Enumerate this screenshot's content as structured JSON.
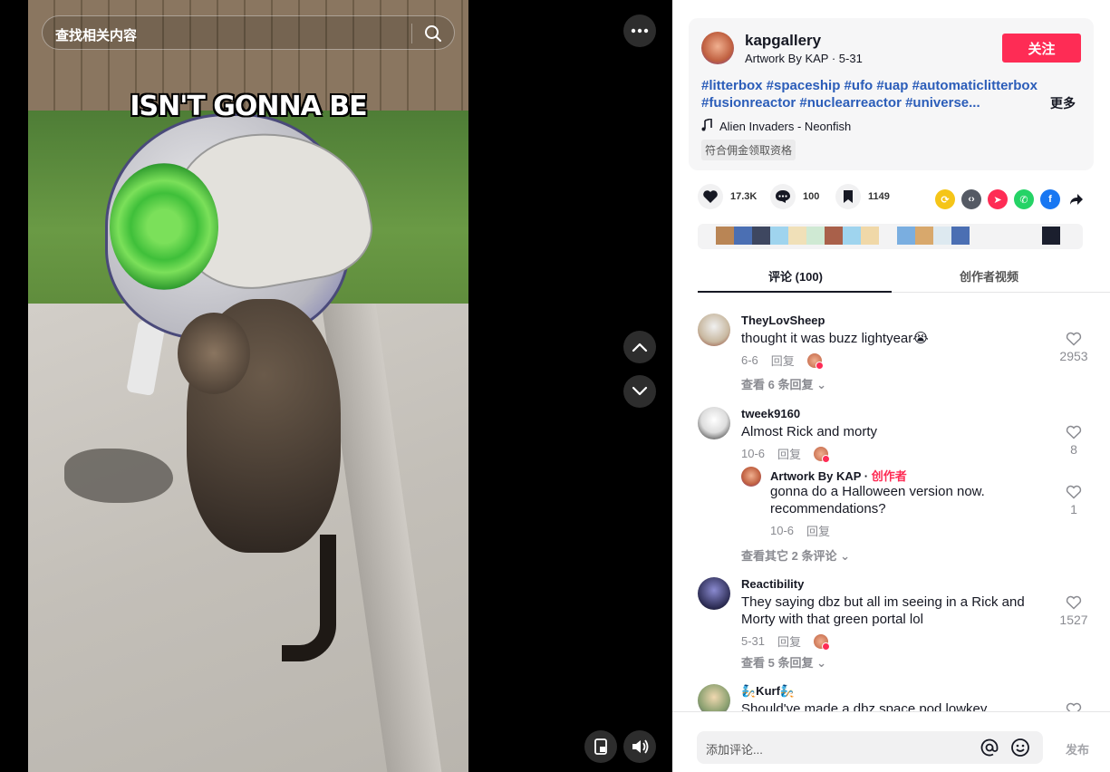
{
  "video": {
    "caption": "ISN'T GONNA BE",
    "search_placeholder": "查找相关内容"
  },
  "author": {
    "username": "kapgallery",
    "display_line": "Artwork By KAP · 5-31",
    "follow_label": "关注"
  },
  "description": {
    "tags_line1": "#litterbox #spaceship #ufo #uap #automaticlitterbox",
    "tags_line2": "#fusionreactor #nuclearreactor #universe...",
    "more_label": "更多",
    "music": "Alien Invaders - Neonfish",
    "commission_label": "符合佣金领取资格"
  },
  "stats": {
    "likes": "17.3K",
    "comments": "100",
    "saves": "1149"
  },
  "tabs": {
    "comments": "评论 (100)",
    "creator_videos": "创作者视频"
  },
  "comments": [
    {
      "user": "TheyLovSheep",
      "text": "thought it was buzz lightyear😭",
      "date": "6-6",
      "reply_label": "回复",
      "likes": "2953",
      "view_replies": "查看 6 条回复"
    },
    {
      "user": "tweek9160",
      "text": "Almost Rick and morty",
      "date": "10-6",
      "reply_label": "回复",
      "likes": "8",
      "reply": {
        "user": "Artwork By KAP",
        "badge": "创作者",
        "text": "gonna do a Halloween version now. recommendations?",
        "date": "10-6",
        "reply_label": "回复",
        "likes": "1"
      },
      "view_replies": "查看其它 2 条评论"
    },
    {
      "user": "Reactibility",
      "text": "They saying dbz but all im seeing in a Rick and Morty with that green portal lol",
      "date": "5-31",
      "reply_label": "回复",
      "likes": "1527",
      "view_replies": "查看 5 条回复"
    },
    {
      "user": "🧞Kurf🧞",
      "text": "Should've made a dbz space pod lowkey"
    }
  ],
  "input": {
    "placeholder": "添加评论...",
    "post_label": "发布"
  },
  "colors": {
    "accent": "#fe2c55",
    "hashtag": "#2b5db9"
  },
  "icons": [
    "search-icon",
    "more-icon",
    "chevron-up-icon",
    "chevron-down-icon",
    "floating-player-icon",
    "volume-icon",
    "heart-icon",
    "comment-icon",
    "bookmark-icon",
    "repost-icon",
    "embed-icon",
    "send-icon",
    "whatsapp-icon",
    "facebook-icon",
    "share-arrow-icon",
    "music-note-icon",
    "at-icon",
    "emoji-icon"
  ]
}
